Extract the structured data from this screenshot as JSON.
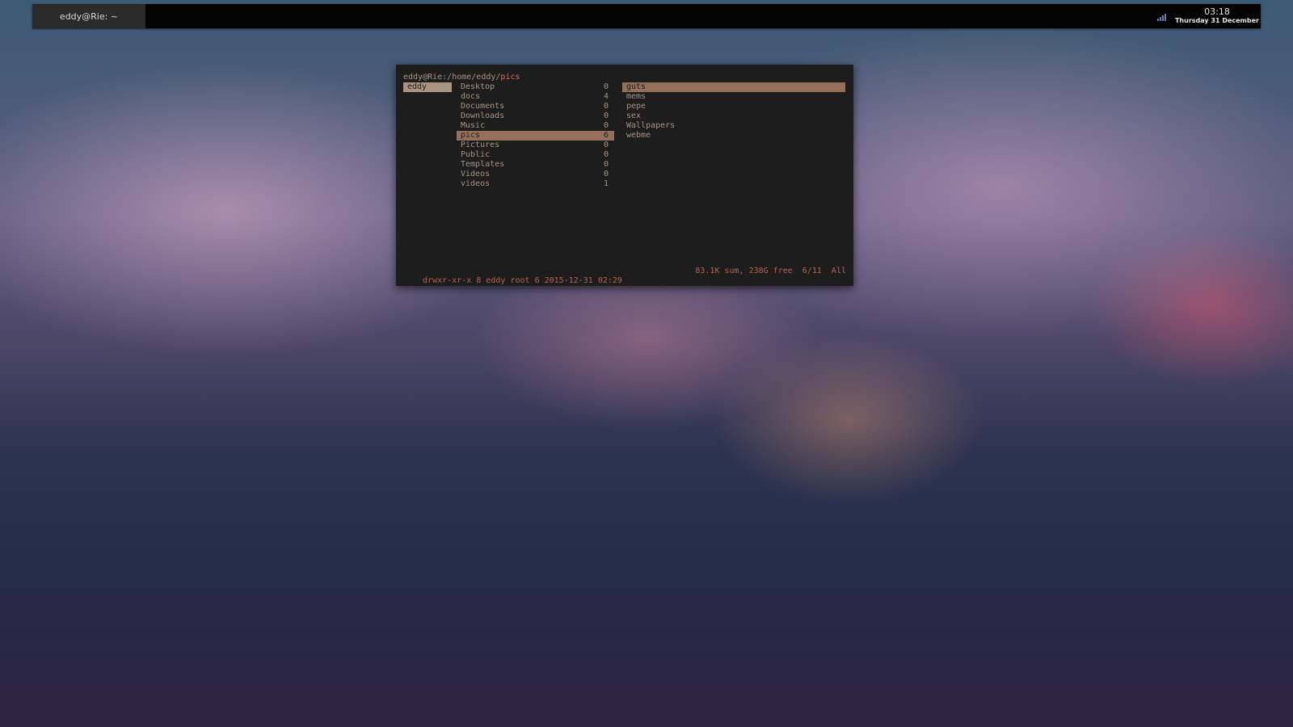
{
  "panel": {
    "task_title": "eddy@Rie: ~",
    "clock_time": "03:18",
    "clock_date": "Thursday 31 December",
    "tray_icon": "signal-icon"
  },
  "terminal": {
    "prompt_prefix": "eddy@Rie:/home/eddy/",
    "prompt_current": "pics",
    "parent_column": [
      {
        "name": "eddy",
        "selected": true
      }
    ],
    "current_column": [
      {
        "name": "Desktop",
        "count": "0"
      },
      {
        "name": "docs",
        "count": "4"
      },
      {
        "name": "Documents",
        "count": "0"
      },
      {
        "name": "Downloads",
        "count": "0"
      },
      {
        "name": "Music",
        "count": "0"
      },
      {
        "name": "pics",
        "count": "6",
        "selected": true
      },
      {
        "name": "Pictures",
        "count": "0"
      },
      {
        "name": "Public",
        "count": "0"
      },
      {
        "name": "Templates",
        "count": "0"
      },
      {
        "name": "Videos",
        "count": "0"
      },
      {
        "name": "videos",
        "count": "1"
      }
    ],
    "preview_column": [
      {
        "name": "guts",
        "selected": true
      },
      {
        "name": "mems"
      },
      {
        "name": "pepe"
      },
      {
        "name": "sex"
      },
      {
        "name": "Wallpapers"
      },
      {
        "name": "webme"
      }
    ],
    "status_left": "drwxr-xr-x 8 eddy root 6 2015-12-31 02:29",
    "status_right": "83.1K sum, 238G free  6/11  All"
  },
  "colors": {
    "terminal_bg": "#1d1d1d",
    "text": "#a69684",
    "selection": "#94705b",
    "status_text": "#b8644f"
  }
}
